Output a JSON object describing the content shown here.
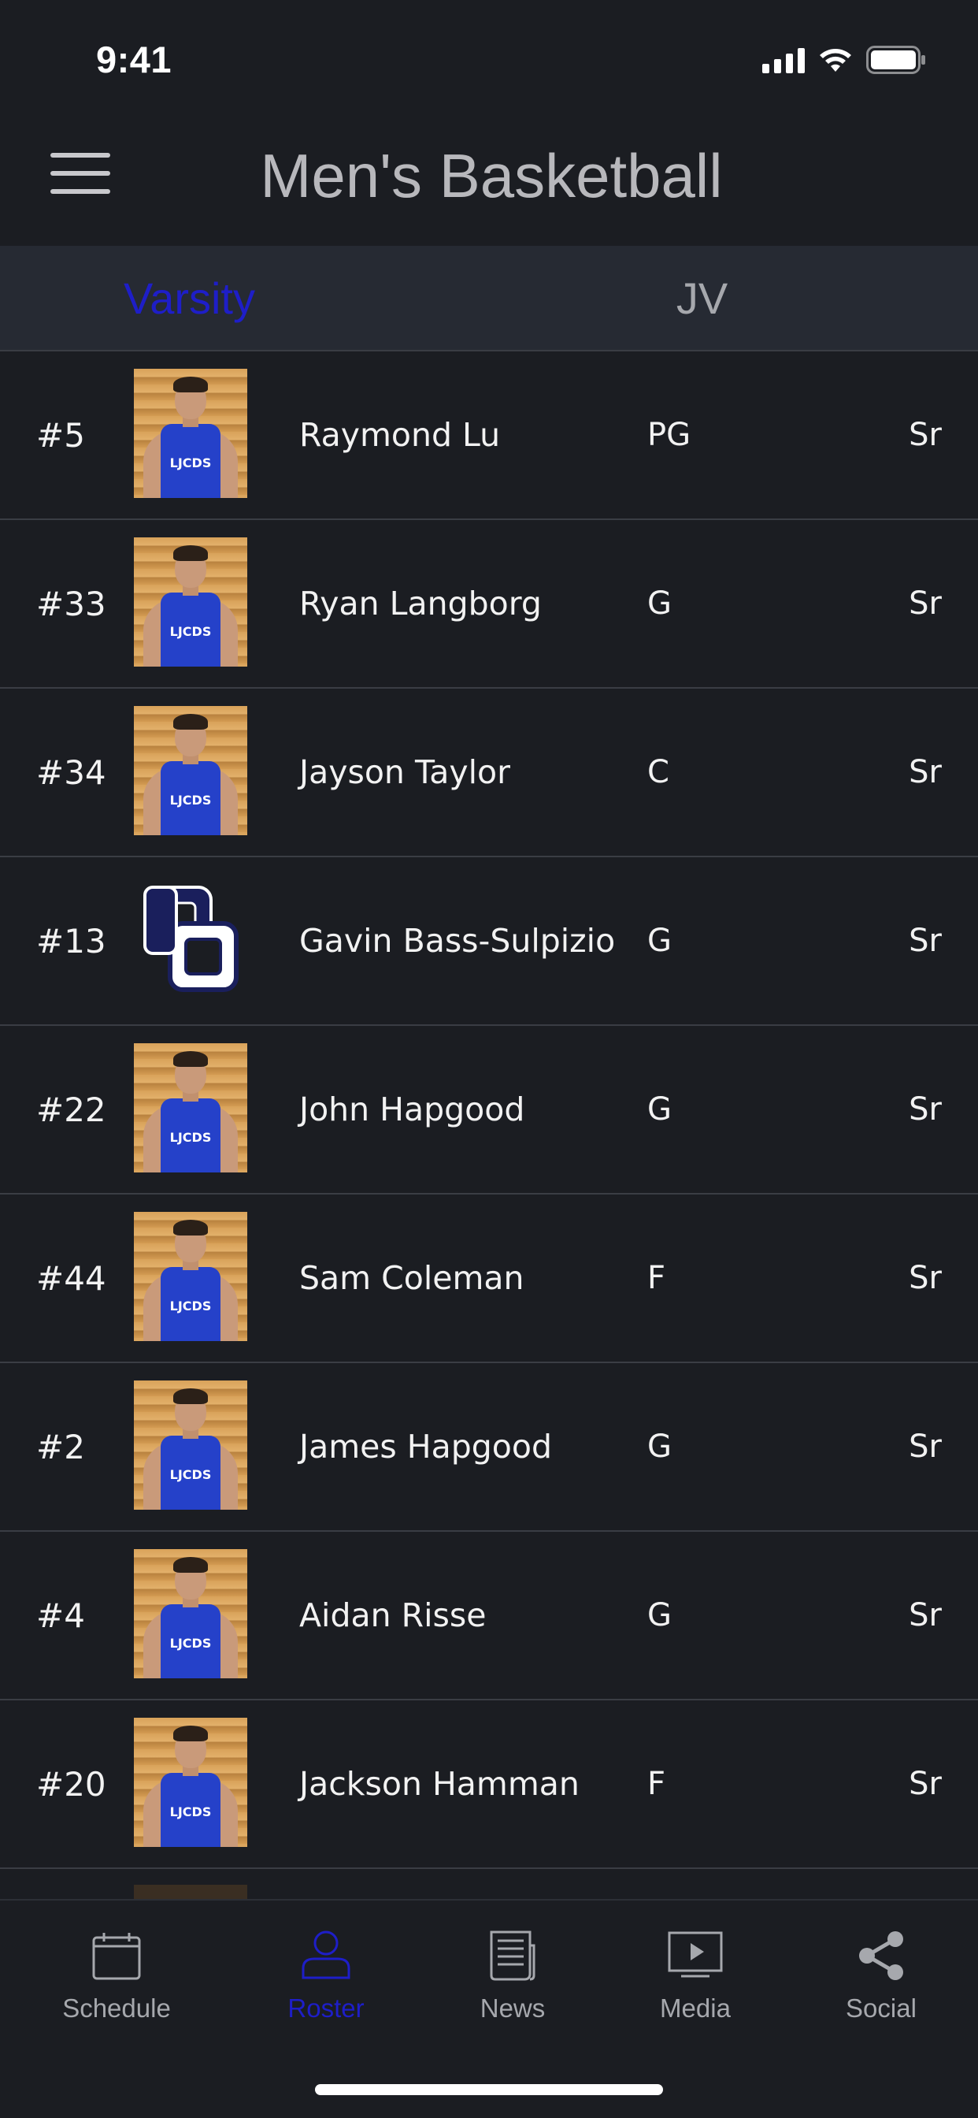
{
  "status_bar": {
    "time": "9:41"
  },
  "header": {
    "title": "Men's Basketball"
  },
  "tabs": [
    {
      "label": "Varsity",
      "active": true
    },
    {
      "label": "JV",
      "active": false
    }
  ],
  "roster": [
    {
      "number": "#5",
      "name": "Raymond Lu",
      "position": "PG",
      "year": "Sr",
      "photo": "player-photo",
      "jersey_text": "LJCDS"
    },
    {
      "number": "#33",
      "name": "Ryan Langborg",
      "position": "G",
      "year": "Sr",
      "photo": "player-photo",
      "jersey_text": "LJCDS"
    },
    {
      "number": "#34",
      "name": "Jayson Taylor",
      "position": "C",
      "year": "Sr",
      "photo": "player-photo",
      "jersey_text": "LJCDS"
    },
    {
      "number": "#13",
      "name": "Gavin Bass-Sulpizio",
      "position": "G",
      "year": "Sr",
      "photo": "school-logo"
    },
    {
      "number": "#22",
      "name": "John Hapgood",
      "position": "G",
      "year": "Sr",
      "photo": "player-photo",
      "jersey_text": "LJCDS"
    },
    {
      "number": "#44",
      "name": "Sam Coleman",
      "position": "F",
      "year": "Sr",
      "photo": "player-photo",
      "jersey_text": "LJCDS"
    },
    {
      "number": "#2",
      "name": "James Hapgood",
      "position": "G",
      "year": "Sr",
      "photo": "player-photo",
      "jersey_text": "LJCDS"
    },
    {
      "number": "#4",
      "name": "Aidan Risse",
      "position": "G",
      "year": "Sr",
      "photo": "player-photo",
      "jersey_text": "LJCDS"
    },
    {
      "number": "#20",
      "name": "Jackson Hamman",
      "position": "F",
      "year": "Sr",
      "photo": "player-photo",
      "jersey_text": "LJCDS"
    }
  ],
  "tabbar": [
    {
      "label": "Schedule",
      "icon": "calendar-icon",
      "active": false
    },
    {
      "label": "Roster",
      "icon": "person-icon",
      "active": true
    },
    {
      "label": "News",
      "icon": "newspaper-icon",
      "active": false
    },
    {
      "label": "Media",
      "icon": "play-screen-icon",
      "active": false
    },
    {
      "label": "Social",
      "icon": "share-icon",
      "active": false
    }
  ],
  "colors": {
    "background": "#1b1d22",
    "tab_strip": "#262a33",
    "active": "#1e1ec8",
    "inactive_text": "#a6a8ad",
    "title_text": "#b8b8bc",
    "divider": "#3a3d44"
  }
}
